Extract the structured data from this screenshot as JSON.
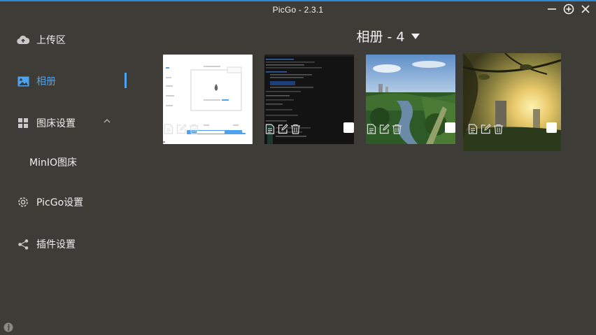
{
  "window": {
    "title": "PicGo - 2.3.1"
  },
  "sidebar": {
    "items": [
      {
        "label": "上传区",
        "icon": "cloud-upload-icon"
      },
      {
        "label": "相册",
        "icon": "image-icon",
        "active": true
      },
      {
        "label": "图床设置",
        "icon": "grid-icon",
        "expanded": true
      },
      {
        "label": "MinIO图床",
        "icon": "",
        "sub": true
      },
      {
        "label": "PicGo设置",
        "icon": "gear-icon"
      },
      {
        "label": "插件设置",
        "icon": "share-icon"
      }
    ]
  },
  "gallery": {
    "title": "相册 - 4",
    "images": [
      {
        "kind": "ui-screenshot"
      },
      {
        "kind": "terminal-screenshot"
      },
      {
        "kind": "river-photo"
      },
      {
        "kind": "sunset-photo"
      }
    ]
  },
  "colors": {
    "background": "#3d3c37",
    "accent": "#4da3ef",
    "text": "#eeeeee"
  }
}
